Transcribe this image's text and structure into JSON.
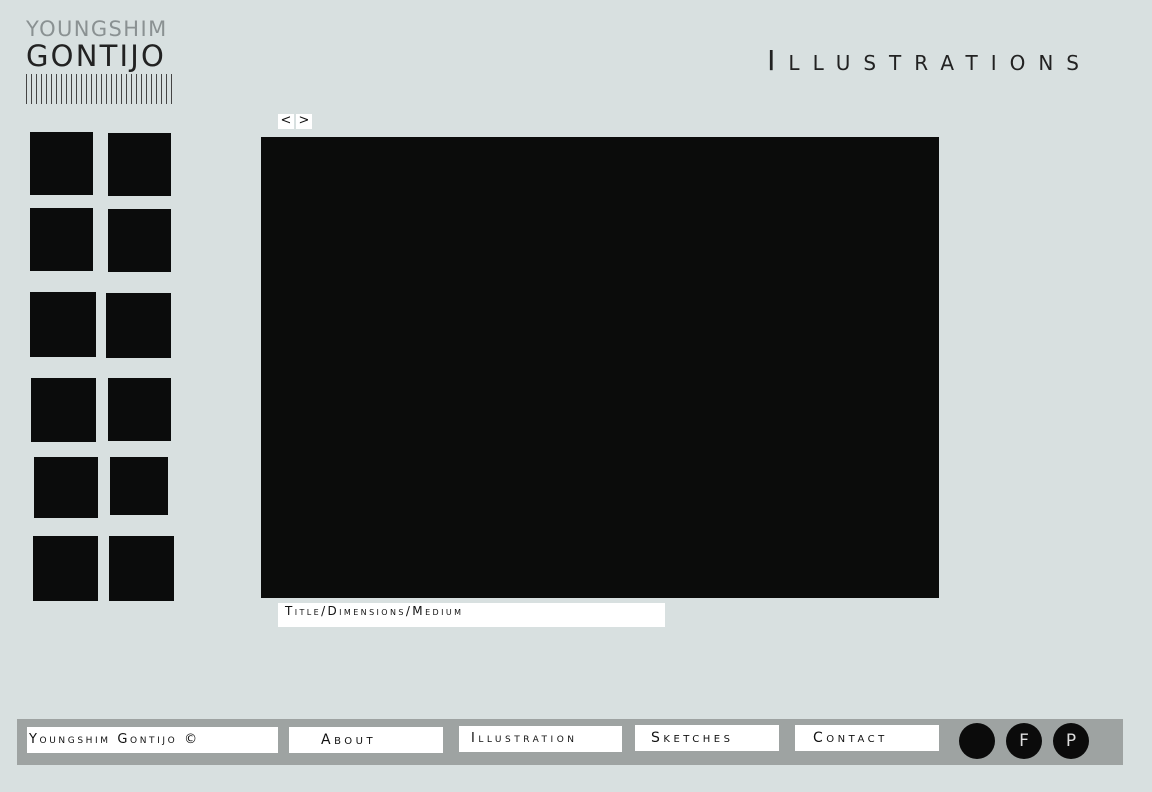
{
  "logo": {
    "first_name": "YOUNGSHIM",
    "last_name": "GONTIJO"
  },
  "header": {
    "title": "Illustrations"
  },
  "gallery": {
    "prev_label": "<",
    "next_label": ">",
    "caption": "Title/Dimensions/Medium",
    "thumbnail_count": 12
  },
  "footer": {
    "copyright": "Youngshim Gontijo ©",
    "nav": [
      "About",
      "Illustration",
      "Sketches",
      "Contact"
    ],
    "social": [
      "",
      "F",
      "P"
    ]
  },
  "colors": {
    "background": "#d8e0e0",
    "footer": "#9ea3a2",
    "image": "#0b0c0b"
  }
}
